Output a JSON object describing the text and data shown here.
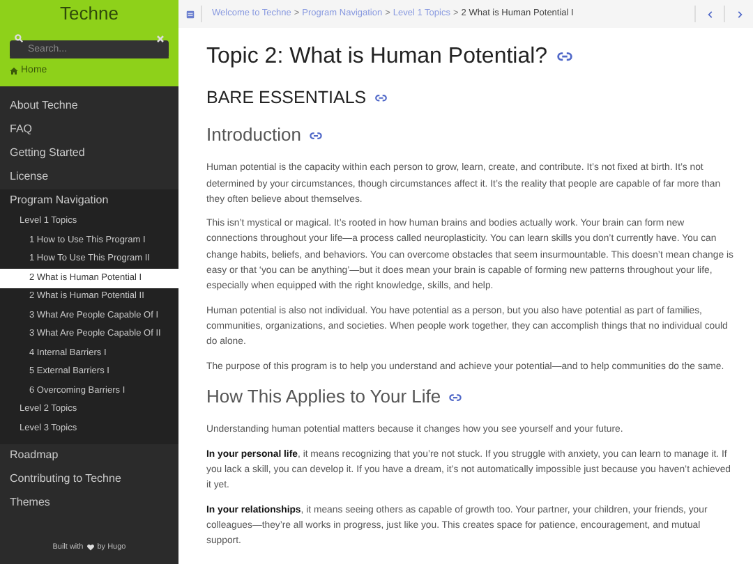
{
  "sidebar": {
    "brand": "Techne",
    "search": {
      "placeholder": "Search..."
    },
    "home": "Home",
    "items": [
      {
        "label": "About Techne",
        "selected": false
      },
      {
        "label": "FAQ",
        "selected": false
      },
      {
        "label": "Getting Started",
        "selected": false
      },
      {
        "label": "License",
        "selected": false
      },
      {
        "label": "Program Navigation",
        "selected": false,
        "children": [
          {
            "label": "Level 1 Topics",
            "selected": false,
            "children": [
              {
                "label": "1 How to Use This Program I",
                "selected": false
              },
              {
                "label": "1 How To Use This Program II",
                "selected": false
              },
              {
                "label": "2 What is Human Potential I",
                "selected": true
              },
              {
                "label": "2 What is Human Potential II",
                "selected": false
              },
              {
                "label": "3 What Are People Capable Of I",
                "selected": false
              },
              {
                "label": "3 What Are People Capable Of II",
                "selected": false
              },
              {
                "label": "4 Internal Barriers I",
                "selected": false
              },
              {
                "label": "5 External Barriers I",
                "selected": false
              },
              {
                "label": "6 Overcoming Barriers I",
                "selected": false
              }
            ]
          },
          {
            "label": "Level 2 Topics",
            "selected": false
          },
          {
            "label": "Level 3 Topics",
            "selected": false
          }
        ]
      },
      {
        "label": "Roadmap",
        "selected": false
      },
      {
        "label": "Contributing to Techne",
        "selected": false
      },
      {
        "label": "Themes",
        "selected": false
      }
    ],
    "footer": {
      "before": "Built with",
      "after": "by Hugo"
    }
  },
  "breadcrumb": {
    "separator": ">",
    "links": [
      "Welcome to Techne",
      "Program Navigation",
      "Level 1 Topics"
    ],
    "current": "2 What is Human Potential I"
  },
  "content": [
    {
      "kind": "h1",
      "text": "Topic 2: What is Human Potential?"
    },
    {
      "kind": "h2",
      "text": "BARE ESSENTIALS"
    },
    {
      "kind": "h3",
      "text": "Introduction"
    },
    {
      "kind": "p",
      "text": "Human potential is the capacity within each person to grow, learn, create, and contribute. It’s not fixed at birth. It’s not determined by your circumstances, though circumstances affect it. It’s the reality that people are capable of far more than they often believe about themselves."
    },
    {
      "kind": "p",
      "text": "This isn’t mystical or magical. It’s rooted in how human brains and bodies actually work. Your brain can form new connections throughout your life—a process called neuroplasticity. You can learn skills you don’t currently have. You can change habits, beliefs, and behaviors. You can overcome obstacles that seem insurmountable. This doesn’t mean change is easy or that ‘you can be anything’—but it does mean your brain is capable of forming new patterns throughout your life, especially when equipped with the right knowledge, skills, and help."
    },
    {
      "kind": "p",
      "text": "Human potential is also not individual. You have potential as a person, but you also have potential as part of families, communities, organizations, and societies. When people work together, they can accomplish things that no individual could do alone."
    },
    {
      "kind": "p",
      "text": "The purpose of this program is to help you understand and achieve your potential—and to help communities do the same."
    },
    {
      "kind": "h3",
      "text": "How This Applies to Your Life"
    },
    {
      "kind": "p",
      "text": "Understanding human potential matters because it changes how you see yourself and your future."
    },
    {
      "kind": "p",
      "text": "**In your personal life**, it means recognizing that you’re not stuck. If you struggle with anxiety, you can learn to manage it. If you lack a skill, you can develop it. If you have a dream, it’s not automatically impossible just because you haven’t achieved it yet."
    },
    {
      "kind": "p",
      "text": "**In your relationships**, it means seeing others as capable of growth too. Your partner, your children, your friends, your colleagues—they’re all works in progress, just like you. This creates space for patience, encouragement, and mutual support."
    }
  ]
}
